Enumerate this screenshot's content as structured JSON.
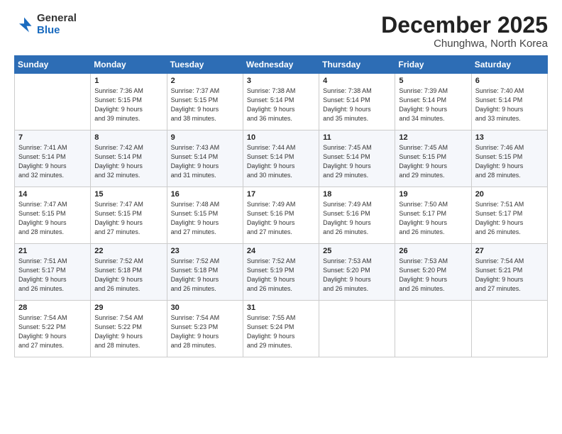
{
  "logo": {
    "general": "General",
    "blue": "Blue"
  },
  "header": {
    "month": "December 2025",
    "location": "Chunghwa, North Korea"
  },
  "weekdays": [
    "Sunday",
    "Monday",
    "Tuesday",
    "Wednesday",
    "Thursday",
    "Friday",
    "Saturday"
  ],
  "weeks": [
    [
      {
        "day": "",
        "info": ""
      },
      {
        "day": "1",
        "info": "Sunrise: 7:36 AM\nSunset: 5:15 PM\nDaylight: 9 hours\nand 39 minutes."
      },
      {
        "day": "2",
        "info": "Sunrise: 7:37 AM\nSunset: 5:15 PM\nDaylight: 9 hours\nand 38 minutes."
      },
      {
        "day": "3",
        "info": "Sunrise: 7:38 AM\nSunset: 5:14 PM\nDaylight: 9 hours\nand 36 minutes."
      },
      {
        "day": "4",
        "info": "Sunrise: 7:38 AM\nSunset: 5:14 PM\nDaylight: 9 hours\nand 35 minutes."
      },
      {
        "day": "5",
        "info": "Sunrise: 7:39 AM\nSunset: 5:14 PM\nDaylight: 9 hours\nand 34 minutes."
      },
      {
        "day": "6",
        "info": "Sunrise: 7:40 AM\nSunset: 5:14 PM\nDaylight: 9 hours\nand 33 minutes."
      }
    ],
    [
      {
        "day": "7",
        "info": "Sunrise: 7:41 AM\nSunset: 5:14 PM\nDaylight: 9 hours\nand 32 minutes."
      },
      {
        "day": "8",
        "info": "Sunrise: 7:42 AM\nSunset: 5:14 PM\nDaylight: 9 hours\nand 32 minutes."
      },
      {
        "day": "9",
        "info": "Sunrise: 7:43 AM\nSunset: 5:14 PM\nDaylight: 9 hours\nand 31 minutes."
      },
      {
        "day": "10",
        "info": "Sunrise: 7:44 AM\nSunset: 5:14 PM\nDaylight: 9 hours\nand 30 minutes."
      },
      {
        "day": "11",
        "info": "Sunrise: 7:45 AM\nSunset: 5:14 PM\nDaylight: 9 hours\nand 29 minutes."
      },
      {
        "day": "12",
        "info": "Sunrise: 7:45 AM\nSunset: 5:15 PM\nDaylight: 9 hours\nand 29 minutes."
      },
      {
        "day": "13",
        "info": "Sunrise: 7:46 AM\nSunset: 5:15 PM\nDaylight: 9 hours\nand 28 minutes."
      }
    ],
    [
      {
        "day": "14",
        "info": "Sunrise: 7:47 AM\nSunset: 5:15 PM\nDaylight: 9 hours\nand 28 minutes."
      },
      {
        "day": "15",
        "info": "Sunrise: 7:47 AM\nSunset: 5:15 PM\nDaylight: 9 hours\nand 27 minutes."
      },
      {
        "day": "16",
        "info": "Sunrise: 7:48 AM\nSunset: 5:15 PM\nDaylight: 9 hours\nand 27 minutes."
      },
      {
        "day": "17",
        "info": "Sunrise: 7:49 AM\nSunset: 5:16 PM\nDaylight: 9 hours\nand 27 minutes."
      },
      {
        "day": "18",
        "info": "Sunrise: 7:49 AM\nSunset: 5:16 PM\nDaylight: 9 hours\nand 26 minutes."
      },
      {
        "day": "19",
        "info": "Sunrise: 7:50 AM\nSunset: 5:17 PM\nDaylight: 9 hours\nand 26 minutes."
      },
      {
        "day": "20",
        "info": "Sunrise: 7:51 AM\nSunset: 5:17 PM\nDaylight: 9 hours\nand 26 minutes."
      }
    ],
    [
      {
        "day": "21",
        "info": "Sunrise: 7:51 AM\nSunset: 5:17 PM\nDaylight: 9 hours\nand 26 minutes."
      },
      {
        "day": "22",
        "info": "Sunrise: 7:52 AM\nSunset: 5:18 PM\nDaylight: 9 hours\nand 26 minutes."
      },
      {
        "day": "23",
        "info": "Sunrise: 7:52 AM\nSunset: 5:18 PM\nDaylight: 9 hours\nand 26 minutes."
      },
      {
        "day": "24",
        "info": "Sunrise: 7:52 AM\nSunset: 5:19 PM\nDaylight: 9 hours\nand 26 minutes."
      },
      {
        "day": "25",
        "info": "Sunrise: 7:53 AM\nSunset: 5:20 PM\nDaylight: 9 hours\nand 26 minutes."
      },
      {
        "day": "26",
        "info": "Sunrise: 7:53 AM\nSunset: 5:20 PM\nDaylight: 9 hours\nand 26 minutes."
      },
      {
        "day": "27",
        "info": "Sunrise: 7:54 AM\nSunset: 5:21 PM\nDaylight: 9 hours\nand 27 minutes."
      }
    ],
    [
      {
        "day": "28",
        "info": "Sunrise: 7:54 AM\nSunset: 5:22 PM\nDaylight: 9 hours\nand 27 minutes."
      },
      {
        "day": "29",
        "info": "Sunrise: 7:54 AM\nSunset: 5:22 PM\nDaylight: 9 hours\nand 28 minutes."
      },
      {
        "day": "30",
        "info": "Sunrise: 7:54 AM\nSunset: 5:23 PM\nDaylight: 9 hours\nand 28 minutes."
      },
      {
        "day": "31",
        "info": "Sunrise: 7:55 AM\nSunset: 5:24 PM\nDaylight: 9 hours\nand 29 minutes."
      },
      {
        "day": "",
        "info": ""
      },
      {
        "day": "",
        "info": ""
      },
      {
        "day": "",
        "info": ""
      }
    ]
  ]
}
